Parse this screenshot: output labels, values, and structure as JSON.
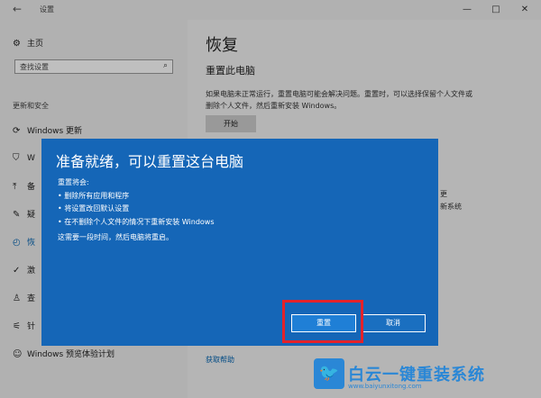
{
  "window": {
    "title": "设置",
    "back_icon": "back-arrow-icon",
    "controls": [
      "—",
      "□",
      "✕"
    ]
  },
  "sidebar": {
    "home": {
      "icon": "gear-icon",
      "label": "主页"
    },
    "search": {
      "placeholder": "查找设置",
      "icon": "search-icon"
    },
    "section": "更新和安全",
    "items": [
      {
        "icon": "refresh-icon",
        "label": "Windows 更新"
      },
      {
        "icon": "shield-icon",
        "label": "W"
      },
      {
        "icon": "backup-icon",
        "label": "备"
      },
      {
        "icon": "wrench-icon",
        "label": "疑"
      },
      {
        "icon": "history-icon",
        "label": "恢"
      },
      {
        "icon": "check-circle-icon",
        "label": "激"
      },
      {
        "icon": "person-icon",
        "label": "查"
      },
      {
        "icon": "dev-icon",
        "label": "针"
      },
      {
        "icon": "smiley-icon",
        "label": "Windows 预览体验计划"
      }
    ]
  },
  "main": {
    "title": "恢复",
    "subtitle": "重置此电脑",
    "description": "如果电脑未正常运行，重置电脑可能会解决问题。重置时，可以选择保留个人文件或删除个人文件，然后重新安装 Windows。",
    "start_button": "开始",
    "right_fragments": [
      "更",
      "新系统"
    ],
    "help_link": "获取帮助"
  },
  "dialog": {
    "title": "准备就绪，可以重置这台电脑",
    "intro": "重置将会:",
    "bullets": [
      "删除所有应用和程序",
      "将设置改回默认设置",
      "在不删除个人文件的情况下重新安装 Windows"
    ],
    "note": "这需要一段时间，然后电脑将重启。",
    "reset_button": "重置",
    "cancel_button": "取消"
  },
  "highlight_color": "#e4222a",
  "watermark": {
    "text": "白云一键重装系统",
    "url": "www.baiyunxitong.com"
  }
}
